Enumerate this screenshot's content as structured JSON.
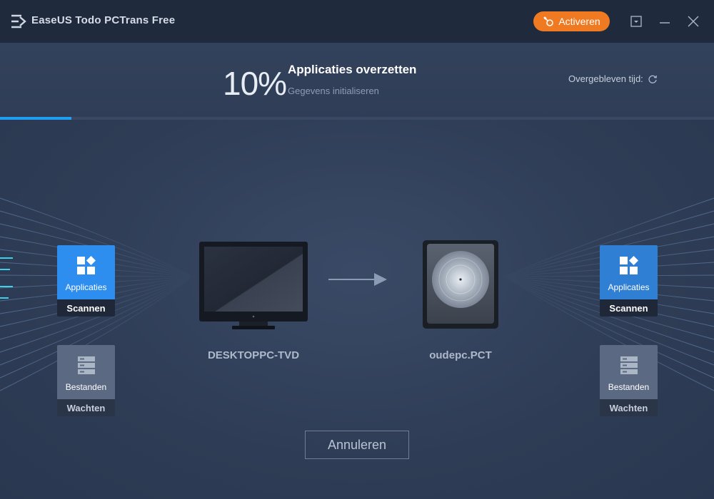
{
  "app": {
    "title": "EaseUS Todo PCTrans Free",
    "activate_label": "Activeren"
  },
  "progress": {
    "percent_text": "10%",
    "percent_value": 10,
    "task_title": "Applicaties overzetten",
    "task_subtitle": "Gegevens initialiseren",
    "remaining_label": "Overgebleven tijd:"
  },
  "source": {
    "device_name": "DESKTOPPC-TVD",
    "tiles": [
      {
        "label": "Applicaties",
        "status": "Scannen"
      },
      {
        "label": "Bestanden",
        "status": "Wachten"
      }
    ]
  },
  "target": {
    "device_name": "oudepc.PCT",
    "tiles": [
      {
        "label": "Applicaties",
        "status": "Scannen"
      },
      {
        "label": "Bestanden",
        "status": "Wachten"
      }
    ]
  },
  "actions": {
    "cancel_label": "Annuleren"
  },
  "colors": {
    "accent": "#f07a22",
    "progress": "#1e9ff2",
    "active_tile": "#2e8ef0"
  }
}
